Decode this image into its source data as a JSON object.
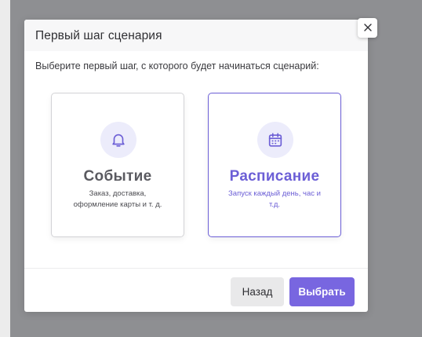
{
  "modal": {
    "title": "Первый шаг сценария",
    "subtitle": "Выберите первый шаг, с которого будет начинаться сценарий:",
    "close_icon": "close-icon"
  },
  "options": [
    {
      "title": "Событие",
      "description": "Заказ, доставка, оформление карты и т. д.",
      "icon": "bell-icon",
      "selected": false
    },
    {
      "title": "Расписание",
      "description": "Запуск каждый день, час и т.д.",
      "icon": "calendar-icon",
      "selected": true
    }
  ],
  "footer": {
    "back_label": "Назад",
    "select_label": "Выбрать"
  },
  "colors": {
    "accent": "#7866e0",
    "selected_border": "#6c5fd6",
    "icon_bg": "#ececfb"
  }
}
